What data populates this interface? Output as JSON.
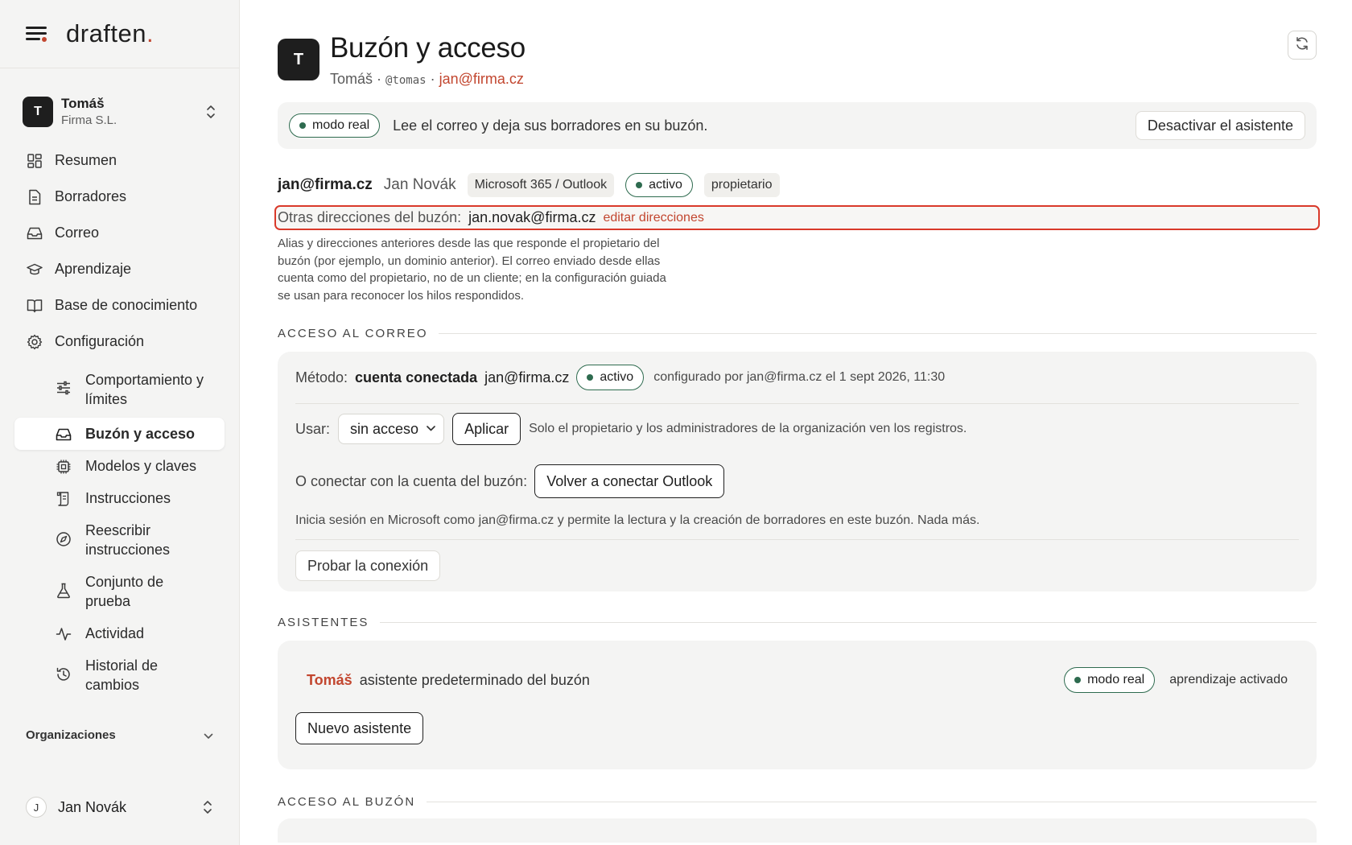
{
  "brand": {
    "logo": "draften",
    "logo_dot": "."
  },
  "account": {
    "avatar": "T",
    "name": "Tomáš",
    "org": "Firma S.L."
  },
  "nav": {
    "items": [
      {
        "label": "Resumen",
        "icon": "grid-icon"
      },
      {
        "label": "Borradores",
        "icon": "document-icon"
      },
      {
        "label": "Correo",
        "icon": "inbox-icon"
      },
      {
        "label": "Aprendizaje",
        "icon": "graduation-cap-icon"
      },
      {
        "label": "Base de conocimiento",
        "icon": "book-icon"
      },
      {
        "label": "Configuración",
        "icon": "gear-icon"
      }
    ],
    "sub_items": [
      {
        "label": "Comportamiento y límites",
        "icon": "sliders-icon"
      },
      {
        "label": "Buzón y acceso",
        "icon": "inbox-icon",
        "active": true
      },
      {
        "label": "Modelos y claves",
        "icon": "chip-icon"
      },
      {
        "label": "Instrucciones",
        "icon": "scroll-icon"
      },
      {
        "label": "Reescribir instrucciones",
        "icon": "compass-icon"
      },
      {
        "label": "Conjunto de prueba",
        "icon": "flask-icon"
      },
      {
        "label": "Actividad",
        "icon": "activity-icon"
      },
      {
        "label": "Historial de cambios",
        "icon": "history-icon"
      }
    ],
    "organizations_label": "Organizaciones"
  },
  "user": {
    "avatar": "J",
    "name": "Jan Novák"
  },
  "header": {
    "avatar": "T",
    "title": "Buzón y acceso",
    "sub_name": "Tomáš",
    "sub_sep1": " · ",
    "sub_handle": "@tomas",
    "sub_sep2": " · ",
    "sub_email": "jan@firma.cz"
  },
  "mode_bar": {
    "pill": "modo real",
    "text": "Lee el correo y deja sus borradores en su buzón.",
    "button": "Desactivar el asistente"
  },
  "mailbox": {
    "email": "jan@firma.cz",
    "name": "Jan Novák",
    "provider": "Microsoft 365 / Outlook",
    "status": "activo",
    "role": "propietario",
    "alt_label": "Otras direcciones del buzón:",
    "alt_value": "jan.novak@firma.cz",
    "alt_edit": "editar direcciones",
    "alt_help": "Alias y direcciones anteriores desde las que responde el propietario del buzón (por ejemplo, un dominio anterior). El correo enviado desde ellas cuenta como del propietario, no de un cliente; en la configuración guiada se usan para reconocer los hilos respondidos."
  },
  "mail_access": {
    "section_title": "ACCESO AL CORREO",
    "method_label": "Método:",
    "method_value": "cuenta conectada",
    "method_email": "jan@firma.cz",
    "method_status": "activo",
    "configured": "configurado por jan@firma.cz el 1 sept 2026, 11:30",
    "use_label": "Usar:",
    "use_select": "sin acceso",
    "apply_button": "Aplicar",
    "use_note": "Solo el propietario y los administradores de la organización ven los registros.",
    "connect_label": "O conectar con la cuenta del buzón:",
    "reconnect_button": "Volver a conectar Outlook",
    "connect_note": "Inicia sesión en Microsoft como jan@firma.cz y permite la lectura y la creación de borradores en este buzón. Nada más.",
    "test_button": "Probar la conexión"
  },
  "assistants": {
    "section_title": "ASISTENTES",
    "name": "Tomáš",
    "desc": "asistente predeterminado del buzón",
    "mode": "modo real",
    "learning": "aprendizaje activado",
    "new_button": "Nuevo asistente"
  },
  "mailbox_access": {
    "section_title": "ACCESO AL BUZÓN"
  },
  "colors": {
    "accent": "#c2462f",
    "status_green": "#2e6b4f",
    "highlight": "#d9392a"
  }
}
